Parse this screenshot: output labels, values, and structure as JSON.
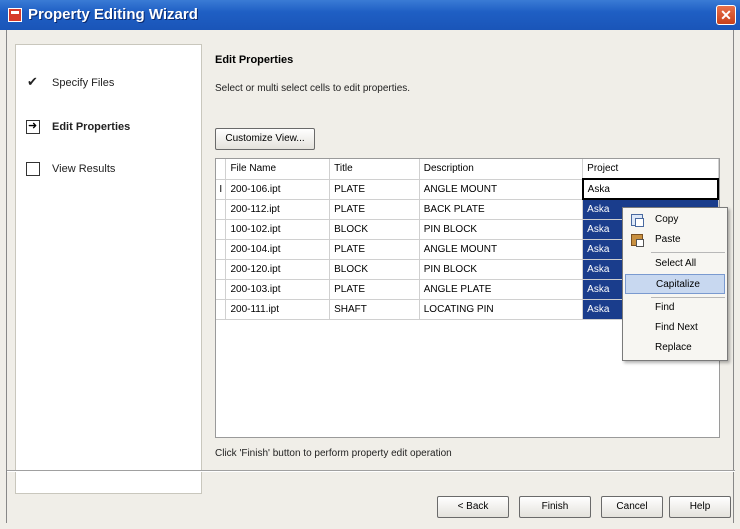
{
  "window": {
    "title": "Property Editing Wizard",
    "close_glyph": "✕"
  },
  "nav": {
    "items": [
      {
        "label": "Specify Files",
        "state": "done"
      },
      {
        "label": "Edit Properties",
        "state": "current"
      },
      {
        "label": "View Results",
        "state": "pending"
      }
    ]
  },
  "main": {
    "heading": "Edit Properties",
    "subheading": "Select or multi select cells to edit properties.",
    "customize_label": "Customize View...",
    "footer_note": "Click 'Finish' button to perform property edit operation"
  },
  "grid": {
    "columns": [
      "File Name",
      "Title",
      "Description",
      "Project"
    ],
    "rows": [
      {
        "marker": "I",
        "file": "200-106.ipt",
        "title": "PLATE",
        "desc": "ANGLE MOUNT",
        "project": "Aska"
      },
      {
        "marker": "",
        "file": "200-112.ipt",
        "title": "PLATE",
        "desc": "BACK PLATE",
        "project": "Aska"
      },
      {
        "marker": "",
        "file": "100-102.ipt",
        "title": "BLOCK",
        "desc": "PIN BLOCK",
        "project": "Aska"
      },
      {
        "marker": "",
        "file": "200-104.ipt",
        "title": "PLATE",
        "desc": "ANGLE MOUNT",
        "project": "Aska"
      },
      {
        "marker": "",
        "file": "200-120.ipt",
        "title": "BLOCK",
        "desc": "PIN BLOCK",
        "project": "Aska"
      },
      {
        "marker": "",
        "file": "200-103.ipt",
        "title": "PLATE",
        "desc": "ANGLE PLATE",
        "project": "Aska"
      },
      {
        "marker": "",
        "file": "200-111.ipt",
        "title": "SHAFT",
        "desc": "LOCATING PIN",
        "project": "Aska"
      }
    ]
  },
  "context_menu": {
    "items": [
      "Copy",
      "Paste",
      "Select All",
      "Capitalize",
      "Find",
      "Find Next",
      "Replace"
    ],
    "highlighted": "Capitalize"
  },
  "buttons": {
    "back": "< Back",
    "finish": "Finish",
    "cancel": "Cancel",
    "help": "Help"
  },
  "colors": {
    "titlebar": "#1f5fc4",
    "selection": "#1a3d8c",
    "menu_highlight": "#c8d8f0"
  }
}
